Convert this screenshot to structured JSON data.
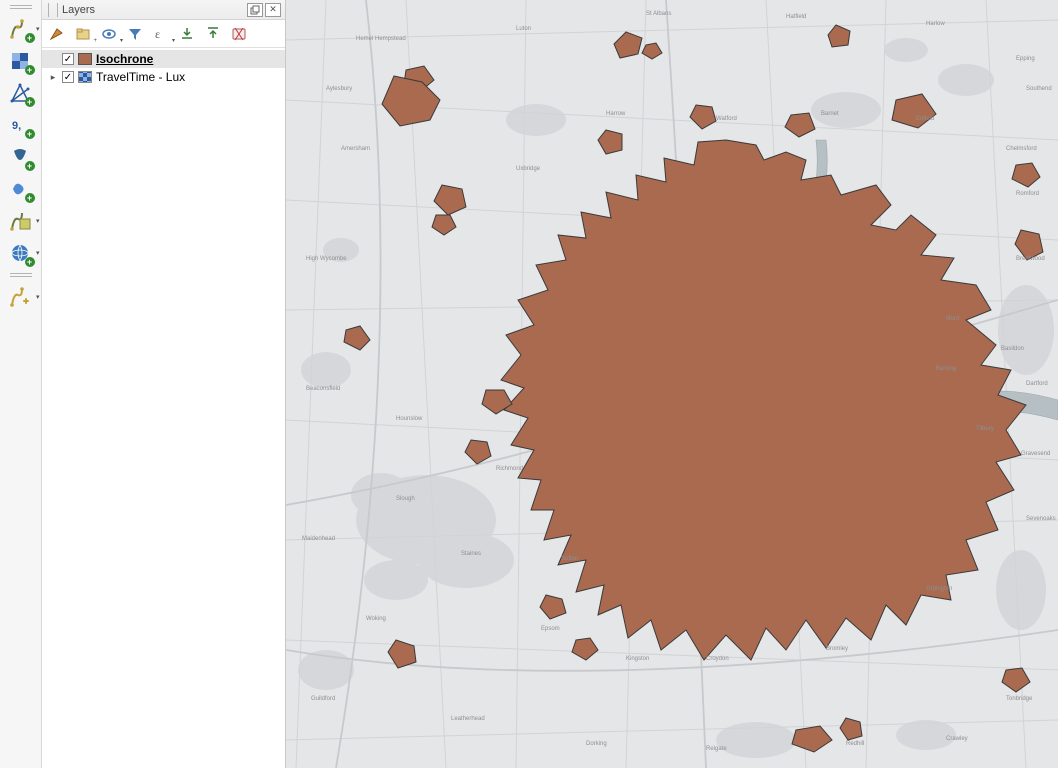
{
  "panel": {
    "title": "Layers"
  },
  "layers": [
    {
      "name": "Isochrone",
      "swatch": "#a96a50",
      "checked": true,
      "active": true,
      "expandable": false
    },
    {
      "name": "TravelTime - Lux",
      "swatch_type": "raster",
      "checked": true,
      "active": false,
      "expandable": true
    }
  ],
  "colors": {
    "isochrone_fill": "#a96a50"
  },
  "map_labels": [
    "Watford",
    "Harrow",
    "Enfield",
    "Barnet",
    "Romford",
    "Basildon",
    "Dartford",
    "Croydon",
    "Bromley",
    "Kingston",
    "Sutton",
    "Richmond",
    "Slough",
    "Uxbridge",
    "Woking",
    "Guildford",
    "Reigate",
    "Sevenoaks",
    "Epping",
    "Brentwood",
    "St Albans",
    "Hemel Hempstead",
    "Chelmsford",
    "High Wycombe",
    "Maidenhead",
    "Gravesend",
    "Orpington",
    "Epsom",
    "Staines",
    "Hounslow",
    "Ilford",
    "Barking",
    "Redhill",
    "Crawley",
    "Tonbridge",
    "Aylesbury",
    "Luton",
    "Harlow",
    "Hatfield",
    "Southend",
    "Tilbury",
    "Dorking",
    "Leatherhead",
    "Amersham",
    "Beaconsfield"
  ]
}
